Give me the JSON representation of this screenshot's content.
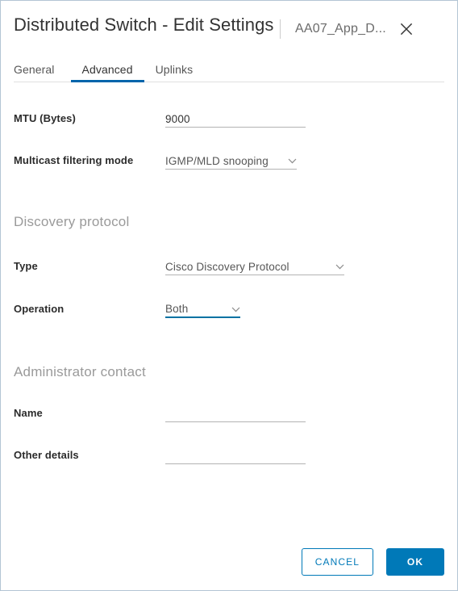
{
  "dialog": {
    "title": "Distributed Switch - Edit Settings",
    "object_name": "AA07_App_D...",
    "close_icon": "close-icon",
    "accent_color": "#0079b8",
    "tab_indicator_color": "#0065ab",
    "focus_underline_color": "#0072a3"
  },
  "tabs": [
    {
      "label": "General",
      "active": false
    },
    {
      "label": "Advanced",
      "active": true
    },
    {
      "label": "Uplinks",
      "active": false
    }
  ],
  "form": {
    "mtu": {
      "label": "MTU (Bytes)",
      "value": "9000",
      "placeholder": ""
    },
    "multicast": {
      "label": "Multicast filtering mode",
      "value": "IGMP/MLD snooping",
      "caret_icon": "chevron-down-icon"
    },
    "discovery_section": {
      "title": "Discovery protocol",
      "type": {
        "label": "Type",
        "value": "Cisco Discovery Protocol",
        "caret_icon": "chevron-down-icon"
      },
      "operation": {
        "label": "Operation",
        "value": "Both",
        "caret_icon": "chevron-down-icon",
        "focused": true
      }
    },
    "admin_section": {
      "title": "Administrator contact",
      "name": {
        "label": "Name",
        "value": "",
        "placeholder": ""
      },
      "other_details": {
        "label": "Other details",
        "value": "",
        "placeholder": ""
      }
    }
  },
  "footer": {
    "cancel_label": "CANCEL",
    "ok_label": "OK"
  }
}
